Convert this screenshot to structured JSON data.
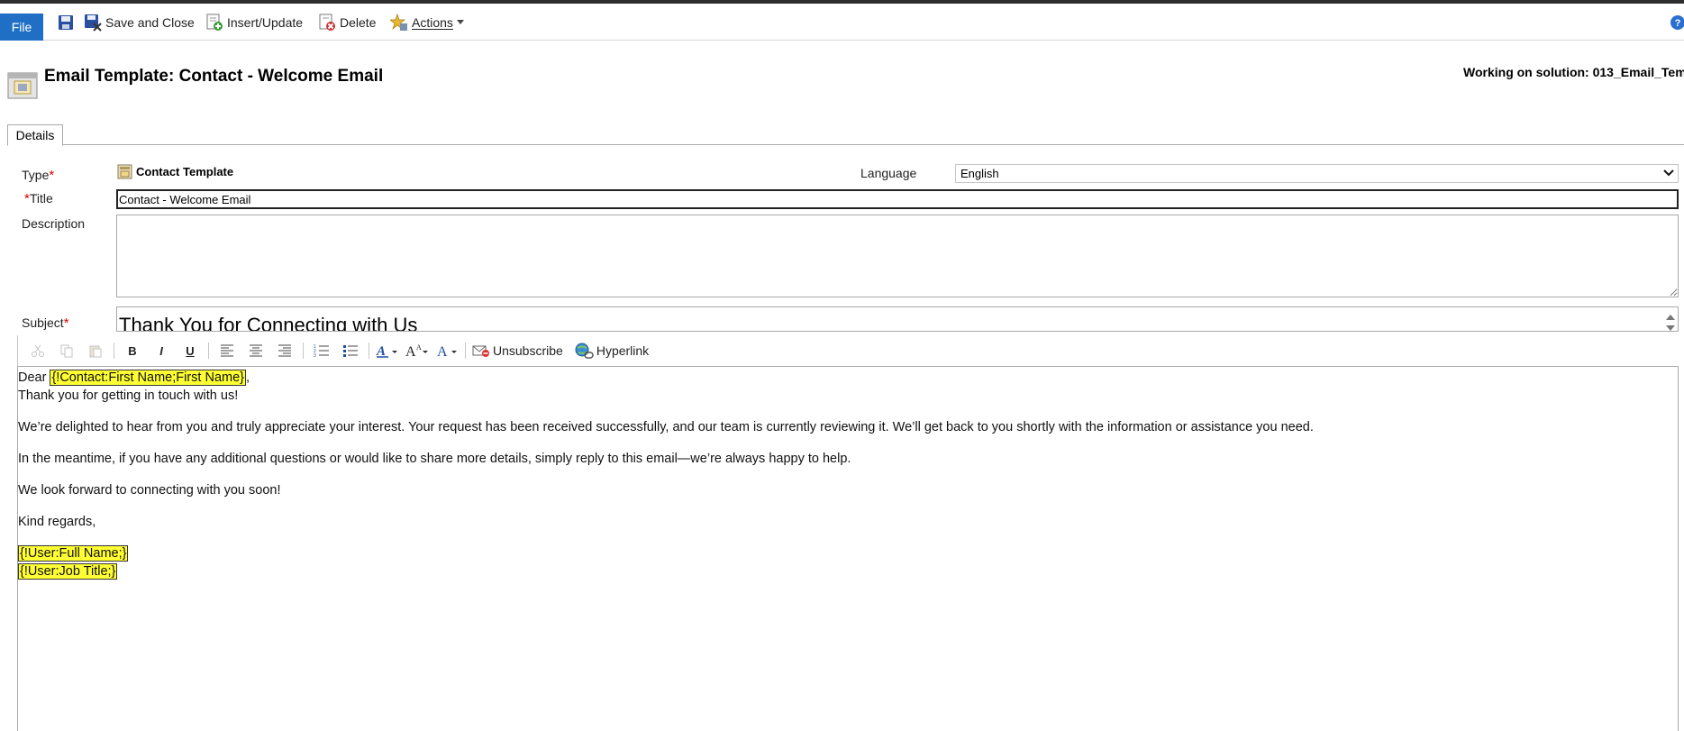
{
  "ribbon": {
    "file_label": "File",
    "save_close_label": "Save and Close",
    "insert_update_label": "Insert/Update",
    "delete_label": "Delete",
    "actions_label": "Actions"
  },
  "header": {
    "title": "Email Template: Contact - Welcome Email",
    "solution_text": "Working on solution: 013_Email_Temp"
  },
  "tabs": [
    {
      "label": "Details"
    }
  ],
  "form": {
    "type_label": "Type",
    "type_value": "Contact Template",
    "language_label": "Language",
    "language_value": "English",
    "title_label": "Title",
    "title_value": "Contact - Welcome Email",
    "description_label": "Description",
    "description_value": "",
    "subject_label": "Subject",
    "subject_value": "Thank You for Connecting with Us",
    "required_mark": "*"
  },
  "editor_toolbar": {
    "bold": "B",
    "italic": "I",
    "underline": "U",
    "unsubscribe_label": "Unsubscribe",
    "hyperlink_label": "Hyperlink"
  },
  "body": {
    "greeting_prefix": "Dear",
    "greeting_slug": "{!Contact:First Name;First Name}",
    "greeting_suffix": ",",
    "line1": "Thank you for getting in touch with us!",
    "para1": "We’re delighted to hear from you and truly appreciate your interest. Your request has been received successfully, and our team is currently reviewing it. We’ll get back to you shortly with the information or assistance you need.",
    "para2": "In the meantime, if you have any additional questions or would like to share more details, simply reply to this email—we’re always happy to help.",
    "para3": "We look forward to connecting with you soon!",
    "closing": "Kind regards,",
    "sig_name_slug": "{!User:Full Name;}",
    "sig_title_slug": "{!User:Job Title;}"
  },
  "colors": {
    "file_button": "#1f6fc5",
    "slug_highlight": "#ffff33",
    "required": "#d00000"
  }
}
